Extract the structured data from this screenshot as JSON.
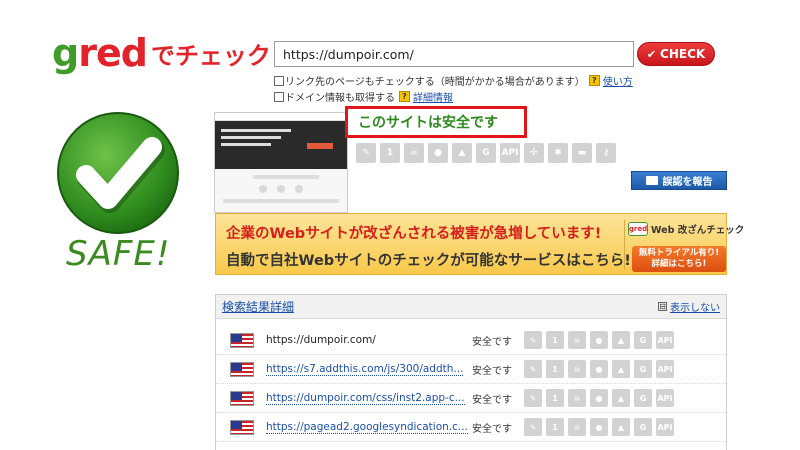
{
  "logo": {
    "g": "g",
    "r": "r",
    "e": "e",
    "d": "d",
    "suffix": "でチェック"
  },
  "url_input": {
    "value": "https://dumpoir.com/"
  },
  "check_button": {
    "label": "CHECK"
  },
  "options": {
    "link_check": {
      "label": "リンク先のページもチェックする（時間がかかる場合があります）",
      "help_link": "使い方"
    },
    "domain_info": {
      "label": "ドメイン情報も取得する",
      "help_link": "詳細情報"
    }
  },
  "safe_badge": {
    "text": "SAFE!"
  },
  "verdict": {
    "message": "このサイトは安全です"
  },
  "check_icons": [
    "feather-icon",
    "document-icon",
    "skull-icon",
    "drop-icon",
    "flame-icon",
    "G",
    "API",
    "network-icon",
    "bug-icon",
    "tag-icon",
    "key-icon"
  ],
  "check_icon_labels": {
    "g": "G",
    "api": "API",
    "doc": "1"
  },
  "report_button": {
    "label": "誤認を報告"
  },
  "banner": {
    "line1": "企業のWebサイトが改ざんされる被害が急増しています!",
    "line2": "自動で自社Webサイトのチェックが可能なサービスはこちら!",
    "service": "Web 改ざんチェック",
    "service_logo": "gred",
    "trial_line1": "無料トライアル有り!",
    "trial_line2": "詳細はこちら!"
  },
  "results": {
    "title": "検索結果詳細",
    "toggle_box": "⊟",
    "toggle_label": "表示しない",
    "rows": [
      {
        "url": "https://dumpoir.com/",
        "status": "安全です"
      },
      {
        "url": "https://s7.addthis.com/js/300/addth...",
        "status": "安全です"
      },
      {
        "url": "https://dumpoir.com/css/inst2.app-c...",
        "status": "安全です"
      },
      {
        "url": "https://pagead2.googlesyndication.c...",
        "status": "安全です"
      }
    ]
  },
  "colors": {
    "brand_red": "#e3232b",
    "brand_green": "#3f9b2a",
    "link_blue": "#1a4fa8"
  }
}
